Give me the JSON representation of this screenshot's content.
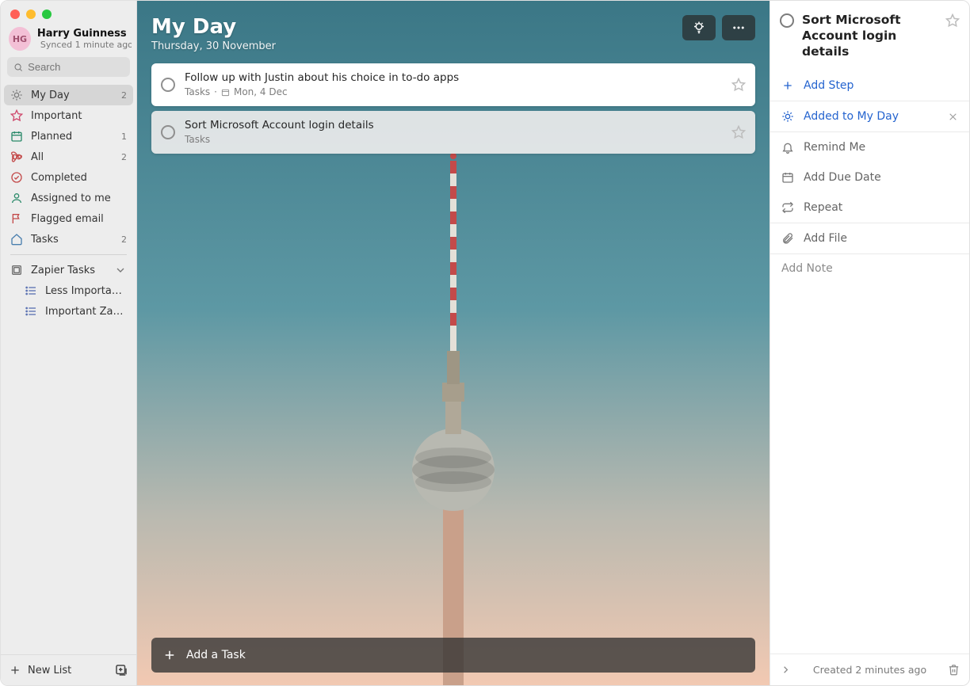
{
  "profile": {
    "initials": "HG",
    "name": "Harry Guinness",
    "sync_status": "Synced 1 minute ago"
  },
  "search": {
    "placeholder": "Search"
  },
  "sidebar": {
    "items": [
      {
        "label": "My Day",
        "count": "2"
      },
      {
        "label": "Important",
        "count": ""
      },
      {
        "label": "Planned",
        "count": "1"
      },
      {
        "label": "All",
        "count": "2"
      },
      {
        "label": "Completed",
        "count": ""
      },
      {
        "label": "Assigned to me",
        "count": ""
      },
      {
        "label": "Flagged email",
        "count": ""
      },
      {
        "label": "Tasks",
        "count": "2"
      }
    ],
    "group": {
      "label": "Zapier Tasks",
      "children": [
        {
          "label": "Less Importan…"
        },
        {
          "label": "Important Zap…"
        }
      ]
    }
  },
  "footer": {
    "new_list": "New List"
  },
  "main": {
    "title": "My Day",
    "date": "Thursday, 30 November",
    "add_task": "Add a Task",
    "tasks": [
      {
        "title": "Follow up with Justin about his choice in to-do apps",
        "list": "Tasks",
        "due": "Mon, 4 Dec"
      },
      {
        "title": "Sort Microsoft Account login details",
        "list": "Tasks",
        "due": ""
      }
    ]
  },
  "detail": {
    "title": "Sort Microsoft Account login details",
    "add_step": "Add Step",
    "my_day": "Added to My Day",
    "remind": "Remind Me",
    "due": "Add Due Date",
    "repeat": "Repeat",
    "file": "Add File",
    "note_placeholder": "Add Note",
    "created": "Created 2 minutes ago"
  }
}
